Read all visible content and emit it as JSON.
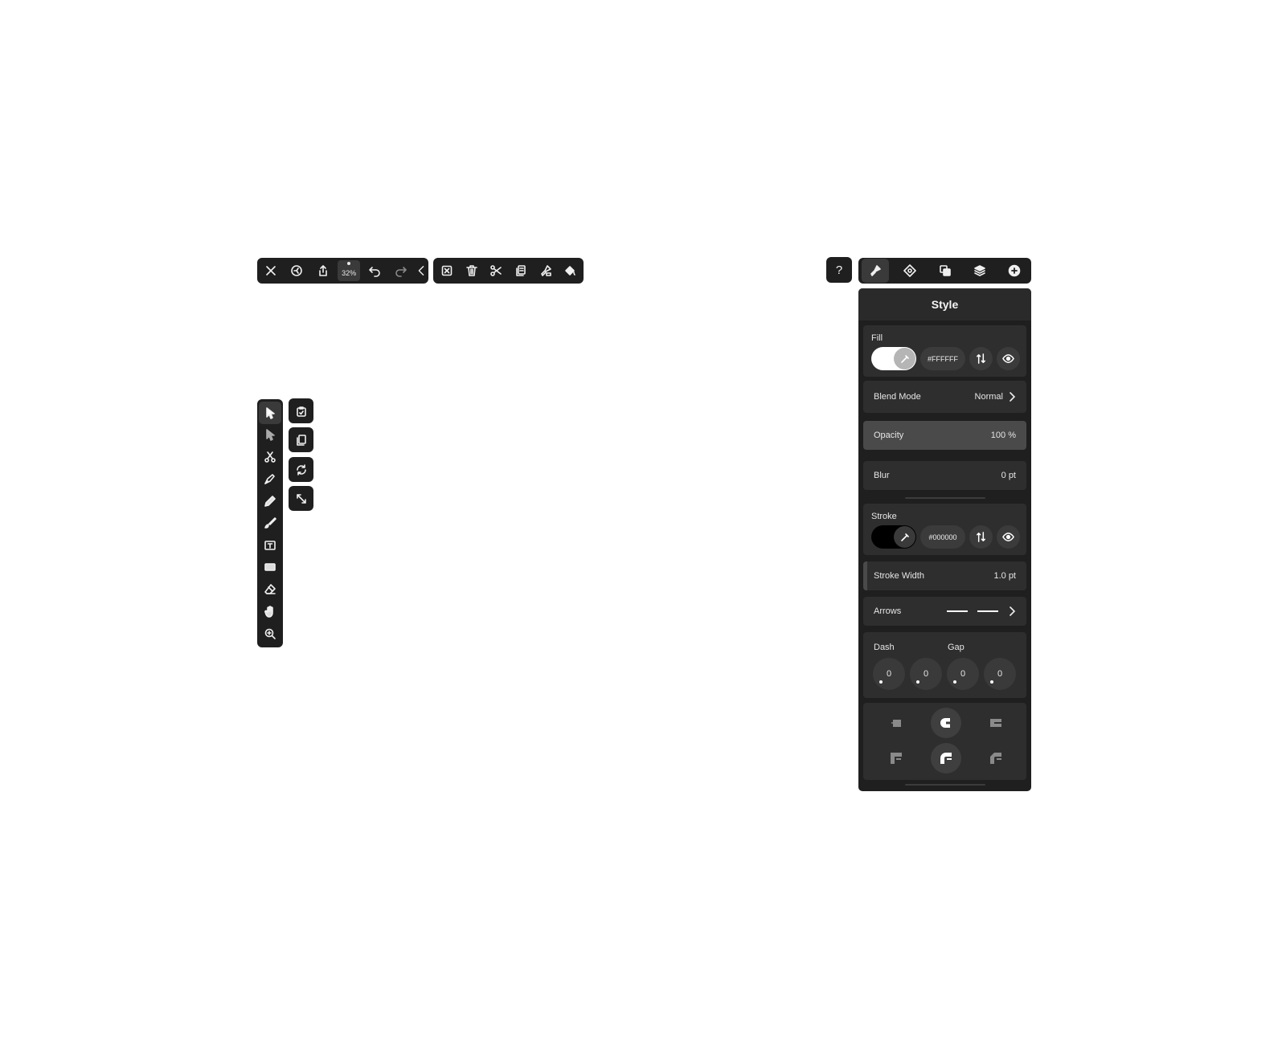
{
  "top_toolbar": {
    "zoom_label": "32%",
    "buttons": [
      "close-icon",
      "settings-icon",
      "share-icon",
      "undo-icon",
      "redo-icon",
      "collapse-chevron-icon"
    ]
  },
  "edit_toolbar": {
    "buttons": [
      "deselect-icon",
      "trash-icon",
      "scissors-icon",
      "duplicate-icon",
      "style-brush-icon",
      "fill-bucket-icon"
    ]
  },
  "tools": [
    "select-arrow-icon",
    "direct-select-icon",
    "scissors-path-icon",
    "pen-icon",
    "pencil-icon",
    "brush-icon",
    "text-tool-icon",
    "rectangle-icon",
    "eraser-icon",
    "hand-icon",
    "zoom-icon"
  ],
  "tool_options": [
    "paste-icon",
    "copy-icon",
    "rotate-icon",
    "resize-icon"
  ],
  "help_label": "?",
  "panel_tabs": [
    "style-tab-icon",
    "shape-tab-icon",
    "arrange-tab-icon",
    "layers-tab-icon",
    "add-tab-icon"
  ],
  "panel": {
    "title": "Style",
    "fill": {
      "label": "Fill",
      "hex": "#FFFFFF",
      "color": "#ffffff"
    },
    "blend": {
      "label": "Blend Mode",
      "value": "Normal"
    },
    "opacity": {
      "label": "Opacity",
      "value": "100 %",
      "level_percent": 100
    },
    "blur": {
      "label": "Blur",
      "value": "0 pt"
    },
    "stroke": {
      "label": "Stroke",
      "hex": "#000000",
      "color": "#000000"
    },
    "stroke_width": {
      "label": "Stroke Width",
      "value": "1.0 pt"
    },
    "arrows": {
      "label": "Arrows"
    },
    "dash": {
      "label": "Dash",
      "values": [
        "0",
        "0"
      ]
    },
    "gap": {
      "label": "Gap",
      "values": [
        "0",
        "0"
      ]
    }
  }
}
